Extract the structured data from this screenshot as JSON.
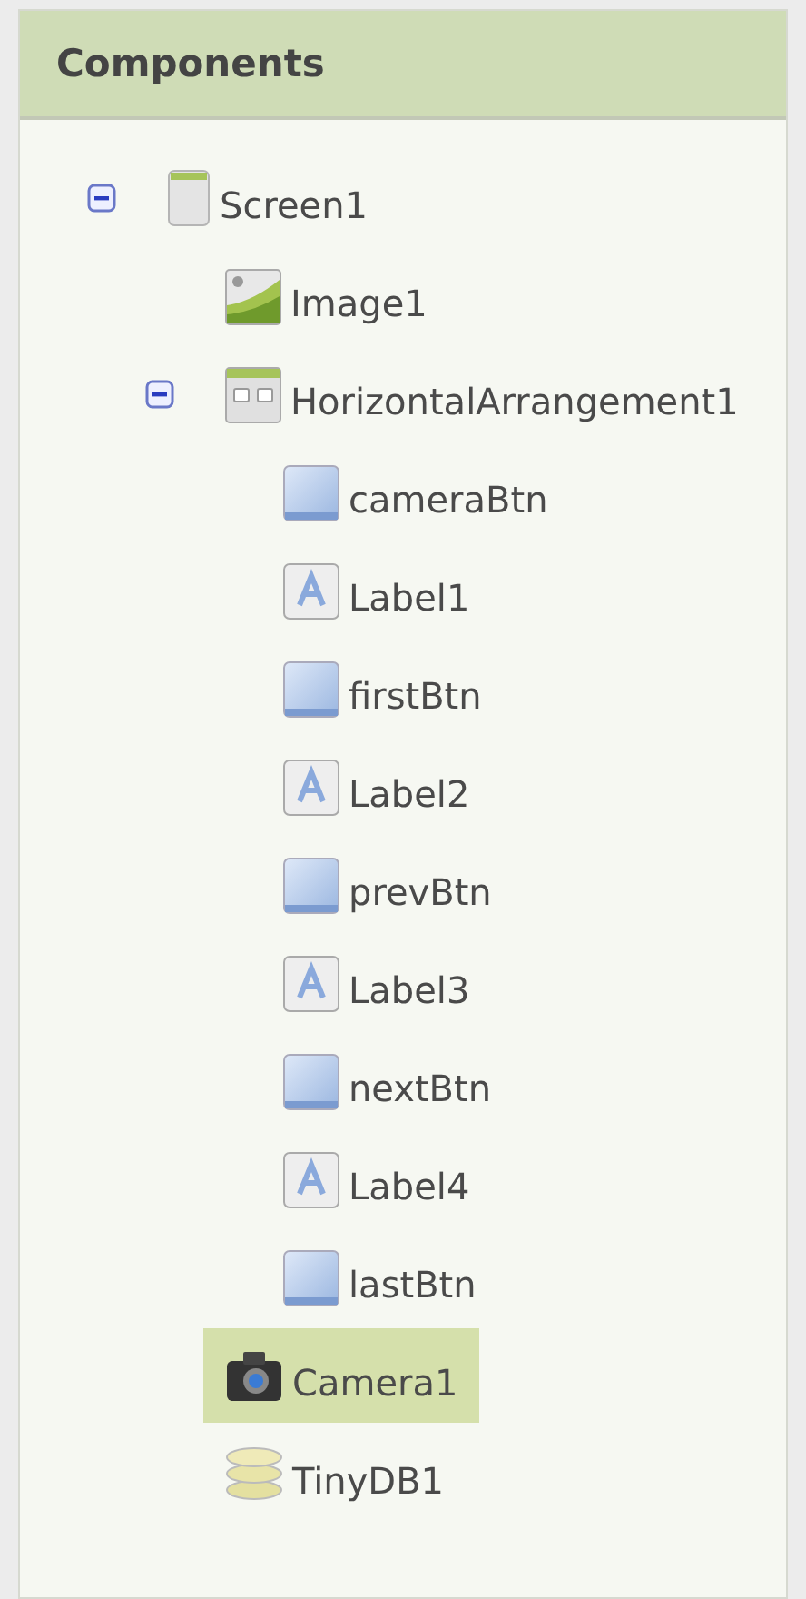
{
  "panel": {
    "title": "Components"
  },
  "tree": [
    {
      "label": "Screen1",
      "kind": "screen",
      "selected": false,
      "expanded": true,
      "children": [
        {
          "label": "Image1",
          "kind": "image",
          "selected": false
        },
        {
          "label": "HorizontalArrangement1",
          "kind": "arrangement",
          "selected": false,
          "expanded": true,
          "children": [
            {
              "label": "cameraBtn",
              "kind": "button",
              "selected": false
            },
            {
              "label": "Label1",
              "kind": "label",
              "selected": false
            },
            {
              "label": "firstBtn",
              "kind": "button",
              "selected": false
            },
            {
              "label": "Label2",
              "kind": "label",
              "selected": false
            },
            {
              "label": "prevBtn",
              "kind": "button",
              "selected": false
            },
            {
              "label": "Label3",
              "kind": "label",
              "selected": false
            },
            {
              "label": "nextBtn",
              "kind": "button",
              "selected": false
            },
            {
              "label": "Label4",
              "kind": "label",
              "selected": false
            },
            {
              "label": "lastBtn",
              "kind": "button",
              "selected": false
            }
          ]
        },
        {
          "label": "Camera1",
          "kind": "camera",
          "selected": true
        },
        {
          "label": "TinyDB1",
          "kind": "tinydb",
          "selected": false
        }
      ]
    }
  ]
}
